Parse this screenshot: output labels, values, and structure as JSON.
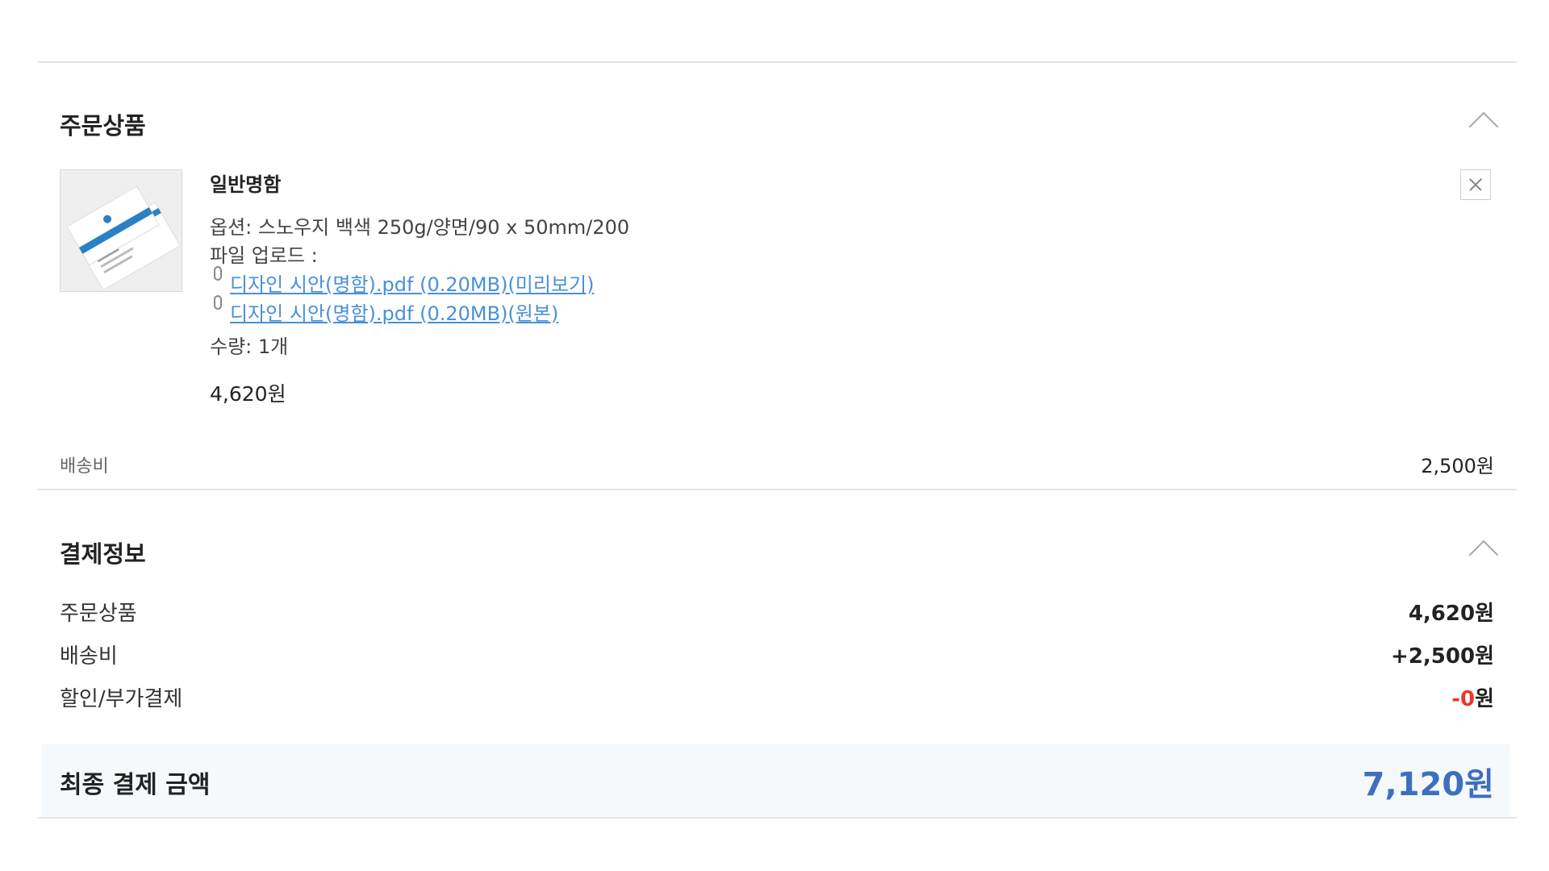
{
  "order_section": {
    "title": "주문상품",
    "item": {
      "name": "일반명함",
      "option": "옵션: 스노우지 백색 250g/양면/90 x 50mm/200",
      "file_label": "파일 업로드 :",
      "files": [
        "디자인 시안(명함).pdf (0.20MB)(미리보기)",
        "디자인 시안(명함).pdf (0.20MB)(원본)"
      ],
      "quantity": "수량: 1개",
      "price": "4,620원"
    },
    "shipping_label": "배송비",
    "shipping_value": "2,500원"
  },
  "payment_section": {
    "title": "결제정보",
    "rows": [
      {
        "label": "주문상품",
        "value": "4,620원"
      },
      {
        "label": "배송비",
        "value": "+2,500원"
      },
      {
        "label": "할인/부가결제",
        "value_sign": "-0",
        "value_unit": "원"
      }
    ],
    "total_label": "최종 결제 금액",
    "total_value": "7,120원"
  },
  "colors": {
    "accent": "#3d6fc1",
    "discount": "#e8382f",
    "link": "#4a90d9"
  },
  "icons": [
    "chevron-up-icon",
    "close-icon",
    "paperclip-icon"
  ]
}
